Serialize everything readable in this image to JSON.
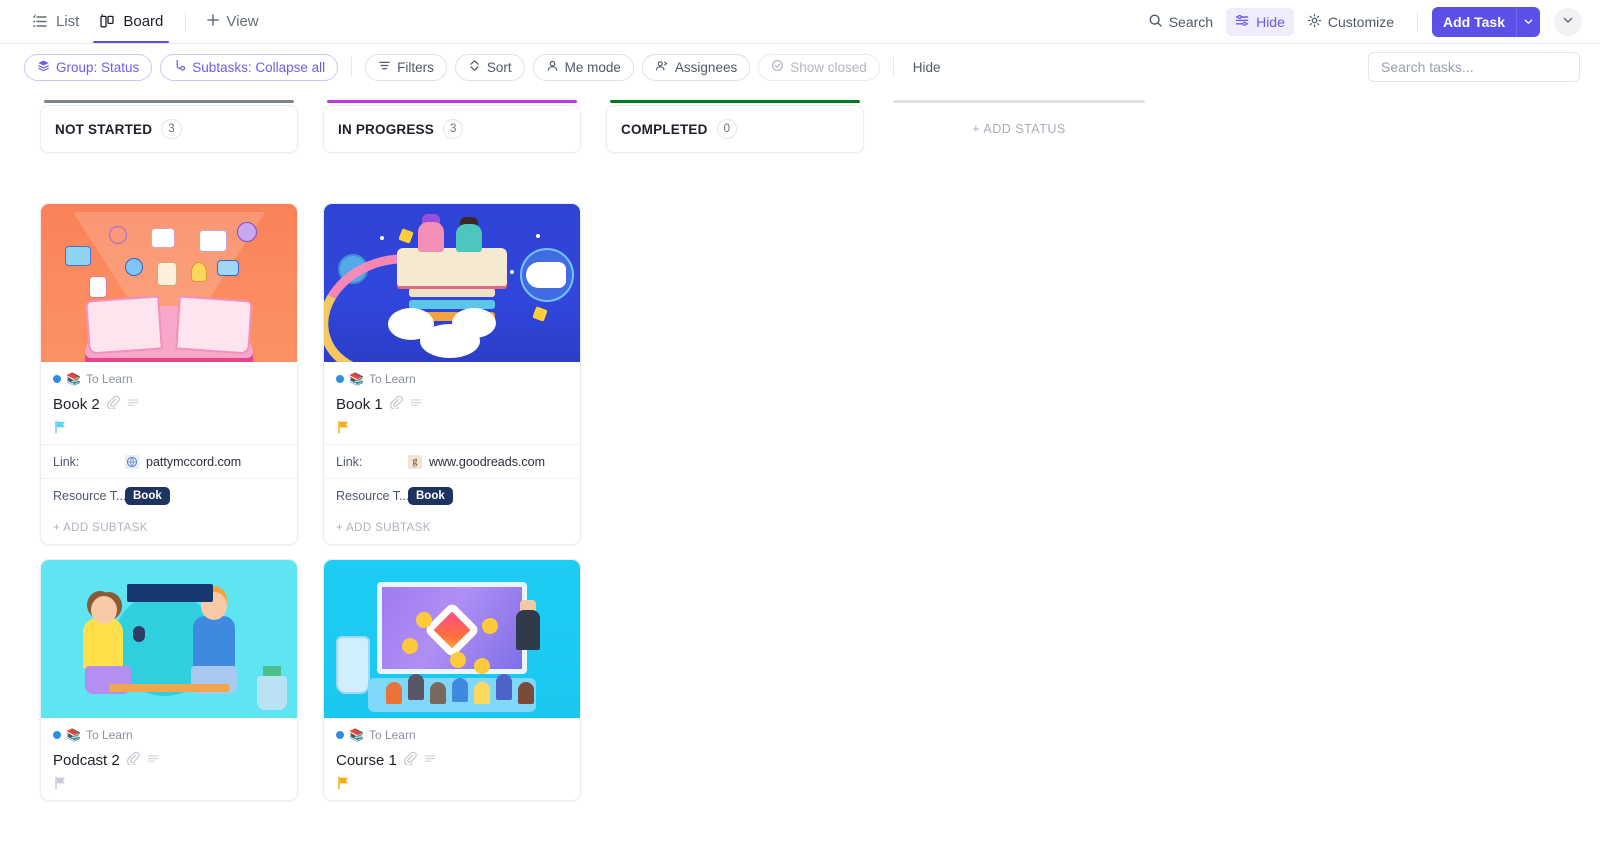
{
  "viewbar": {
    "tabs": [
      {
        "label": "List",
        "icon": "list-icon",
        "active": false
      },
      {
        "label": "Board",
        "icon": "board-icon",
        "active": true
      }
    ],
    "add_view_label": "View",
    "right_actions": [
      {
        "label": "Search",
        "icon": "search-icon",
        "highlight": false
      },
      {
        "label": "Hide",
        "icon": "sliders-icon",
        "highlight": true
      },
      {
        "label": "Customize",
        "icon": "gear-icon",
        "highlight": false
      }
    ],
    "add_task_label": "Add Task"
  },
  "filterbar": {
    "chips": [
      {
        "label": "Group: Status",
        "icon": "layers-icon",
        "style": "purple"
      },
      {
        "label": "Subtasks: Collapse all",
        "icon": "subtask-icon",
        "style": "purple"
      },
      {
        "label": "Filters",
        "icon": "filter-icon",
        "style": "plain"
      },
      {
        "label": "Sort",
        "icon": "sort-icon",
        "style": "plain"
      },
      {
        "label": "Me mode",
        "icon": "person-icon",
        "style": "plain"
      },
      {
        "label": "Assignees",
        "icon": "people-icon",
        "style": "plain"
      },
      {
        "label": "Show closed",
        "icon": "check-circle-icon",
        "style": "muted"
      }
    ],
    "hide_label": "Hide",
    "search_placeholder": "Search tasks..."
  },
  "board": {
    "add_status_label": "+ ADD STATUS",
    "add_subtask_label": "+ ADD SUBTASK",
    "columns": [
      {
        "title": "NOT STARTED",
        "count": "3",
        "color": "#7e8590"
      },
      {
        "title": "IN PROGRESS",
        "count": "3",
        "color": "#bb39e0"
      },
      {
        "title": "COMPLETED",
        "count": "0",
        "color": "#037a1e"
      }
    ],
    "cards": [
      {
        "column": 0,
        "status": "To Learn",
        "status_emoji": "📚",
        "title": "Book 2",
        "flag_color": "#5ed3f5",
        "cover": "book2",
        "link_label": "Link:",
        "link_value": "pattymccord.com",
        "favicon": "globe-icon",
        "field_label": "Resource T...",
        "tag": "Book"
      },
      {
        "column": 0,
        "status": "To Learn",
        "status_emoji": "📚",
        "title": "Podcast 2",
        "flag_color": "#c9ccd3",
        "cover": "podcast",
        "link_label": "",
        "link_value": "",
        "favicon": "",
        "field_label": "",
        "tag": ""
      },
      {
        "column": 1,
        "status": "To Learn",
        "status_emoji": "📚",
        "title": "Book 1",
        "flag_color": "#f6ad17",
        "cover": "book1",
        "link_label": "Link:",
        "link_value": "www.goodreads.com",
        "favicon": "g-icon",
        "field_label": "Resource T...",
        "tag": "Book"
      },
      {
        "column": 1,
        "status": "To Learn",
        "status_emoji": "📚",
        "title": "Course 1",
        "flag_color": "#f6ad17",
        "cover": "course",
        "link_label": "",
        "link_value": "",
        "favicon": "",
        "field_label": "",
        "tag": ""
      }
    ]
  },
  "colors": {
    "accent": "#5b50e8",
    "accent_soft": "#eeecfd",
    "tag_bg": "#1d3461",
    "text": "#2b2e3b",
    "muted": "#8b909c"
  }
}
